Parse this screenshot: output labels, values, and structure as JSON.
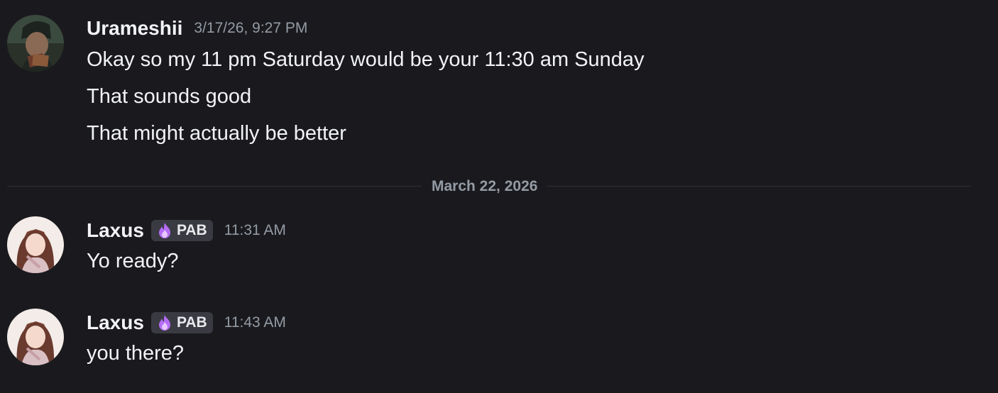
{
  "messages": {
    "group1": {
      "username": "Urameshii",
      "timestamp": "3/17/26, 9:27 PM",
      "lines": [
        "Okay so my 11 pm Saturday would be your 11:30 am Sunday",
        "That sounds good",
        "That might actually be better"
      ]
    },
    "divider": "March 22, 2026",
    "group2": {
      "username": "Laxus",
      "tag": "PAB",
      "timestamp": "11:31 AM",
      "lines": [
        "Yo ready?"
      ]
    },
    "group3": {
      "username": "Laxus",
      "tag": "PAB",
      "timestamp": "11:43 AM",
      "lines": [
        "you there?"
      ]
    }
  },
  "colors": {
    "background": "#1a1a1e",
    "username": "#f2f3f5",
    "muted": "#949ba4",
    "tag_bg": "#3a3a42",
    "tag_icon": "#b56cf5"
  },
  "icons": {
    "tag_icon": "purple-flame-icon"
  }
}
